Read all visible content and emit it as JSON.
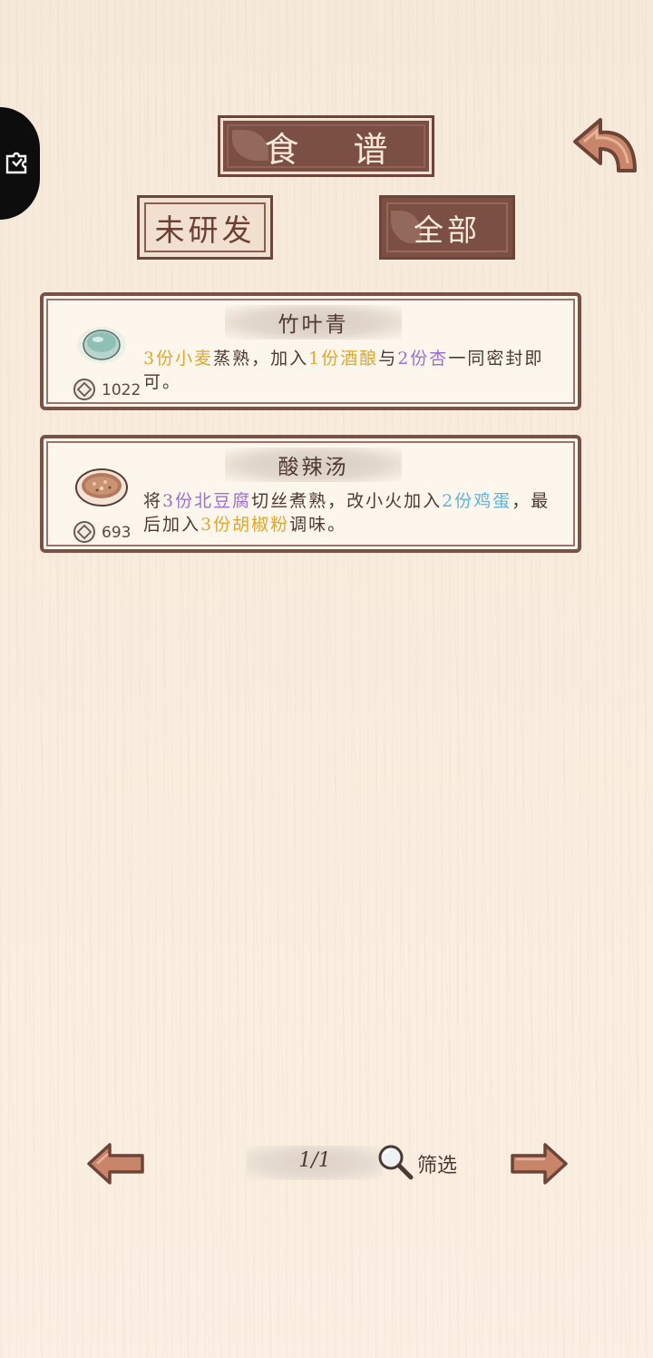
{
  "header": {
    "title": "食 谱"
  },
  "tabs": {
    "undeveloped": "未研发",
    "all": "全部"
  },
  "recipes": [
    {
      "name": "竹叶青",
      "price": "1022",
      "dish_icon": "jade-cup-icon",
      "desc": [
        {
          "text": "3份小麦",
          "color": "yellow"
        },
        {
          "text": "蒸熟，加入",
          "color": "default"
        },
        {
          "text": "1份酒酿",
          "color": "yellow"
        },
        {
          "text": "与",
          "color": "default"
        },
        {
          "text": "2份杏",
          "color": "purple"
        },
        {
          "text": "一同密封即可。",
          "color": "default"
        }
      ]
    },
    {
      "name": "酸辣汤",
      "price": "693",
      "dish_icon": "soup-bowl-icon",
      "desc": [
        {
          "text": "将",
          "color": "default"
        },
        {
          "text": "3份北豆腐",
          "color": "purple"
        },
        {
          "text": "切丝煮熟，改小火加入",
          "color": "default"
        },
        {
          "text": "2份鸡蛋",
          "color": "blue"
        },
        {
          "text": "，最后加入",
          "color": "default"
        },
        {
          "text": "3份胡椒粉",
          "color": "yellow"
        },
        {
          "text": "调味。",
          "color": "default"
        }
      ]
    }
  ],
  "footer": {
    "page": "1/1",
    "filter_label": "筛选"
  },
  "colors": {
    "brown": "#7b4f43",
    "cream": "#fdf6ec",
    "yellow": "#e0a62e",
    "purple": "#9c6fd2",
    "blue": "#5fb3e0"
  }
}
